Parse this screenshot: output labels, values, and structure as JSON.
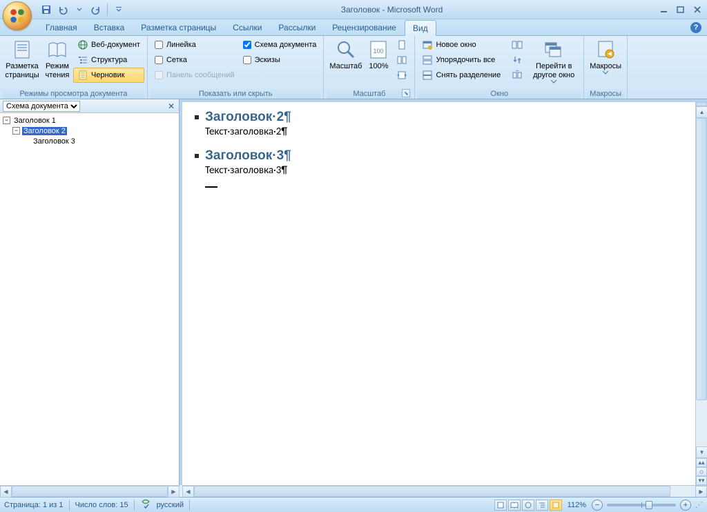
{
  "title": "Заголовок - Microsoft Word",
  "qat": {
    "save": "save-icon",
    "undo": "undo-icon",
    "redo": "redo-icon"
  },
  "tabs": [
    "Главная",
    "Вставка",
    "Разметка страницы",
    "Ссылки",
    "Рассылки",
    "Рецензирование",
    "Вид"
  ],
  "active_tab": 6,
  "ribbon": {
    "views": {
      "label": "Режимы просмотра документа",
      "print_layout": "Разметка страницы",
      "reading": "Режим чтения",
      "web": "Веб-документ",
      "outline": "Структура",
      "draft": "Черновик"
    },
    "show": {
      "label": "Показать или скрыть",
      "ruler": "Линейка",
      "gridlines": "Сетка",
      "message_bar": "Панель сообщений",
      "doc_map": "Схема документа",
      "thumbnails": "Эскизы"
    },
    "zoom": {
      "label": "Масштаб",
      "zoom": "Масштаб",
      "hundred": "100%"
    },
    "window": {
      "label": "Окно",
      "new_window": "Новое окно",
      "arrange": "Упорядочить все",
      "split": "Снять разделение",
      "switch": "Перейти в другое окно"
    },
    "macros": {
      "label": "Макросы",
      "macros": "Макросы"
    }
  },
  "docmap": {
    "title": "Схема документа",
    "items": [
      {
        "level": 0,
        "label": "Заголовок 1",
        "expandable": true,
        "expanded": true
      },
      {
        "level": 1,
        "label": "Заголовок 2",
        "expandable": true,
        "expanded": true,
        "selected": true
      },
      {
        "level": 2,
        "label": "Заголовок 3",
        "expandable": false
      }
    ]
  },
  "document": {
    "h2a": "Заголовок·2¶",
    "p2": "Текст·заголовка·2¶",
    "h2b": "Заголовок·3¶",
    "p3": "Текст·заголовка·3¶"
  },
  "status": {
    "page": "Страница: 1 из 1",
    "words": "Число слов: 15",
    "lang": "русский",
    "zoom": "112%"
  }
}
